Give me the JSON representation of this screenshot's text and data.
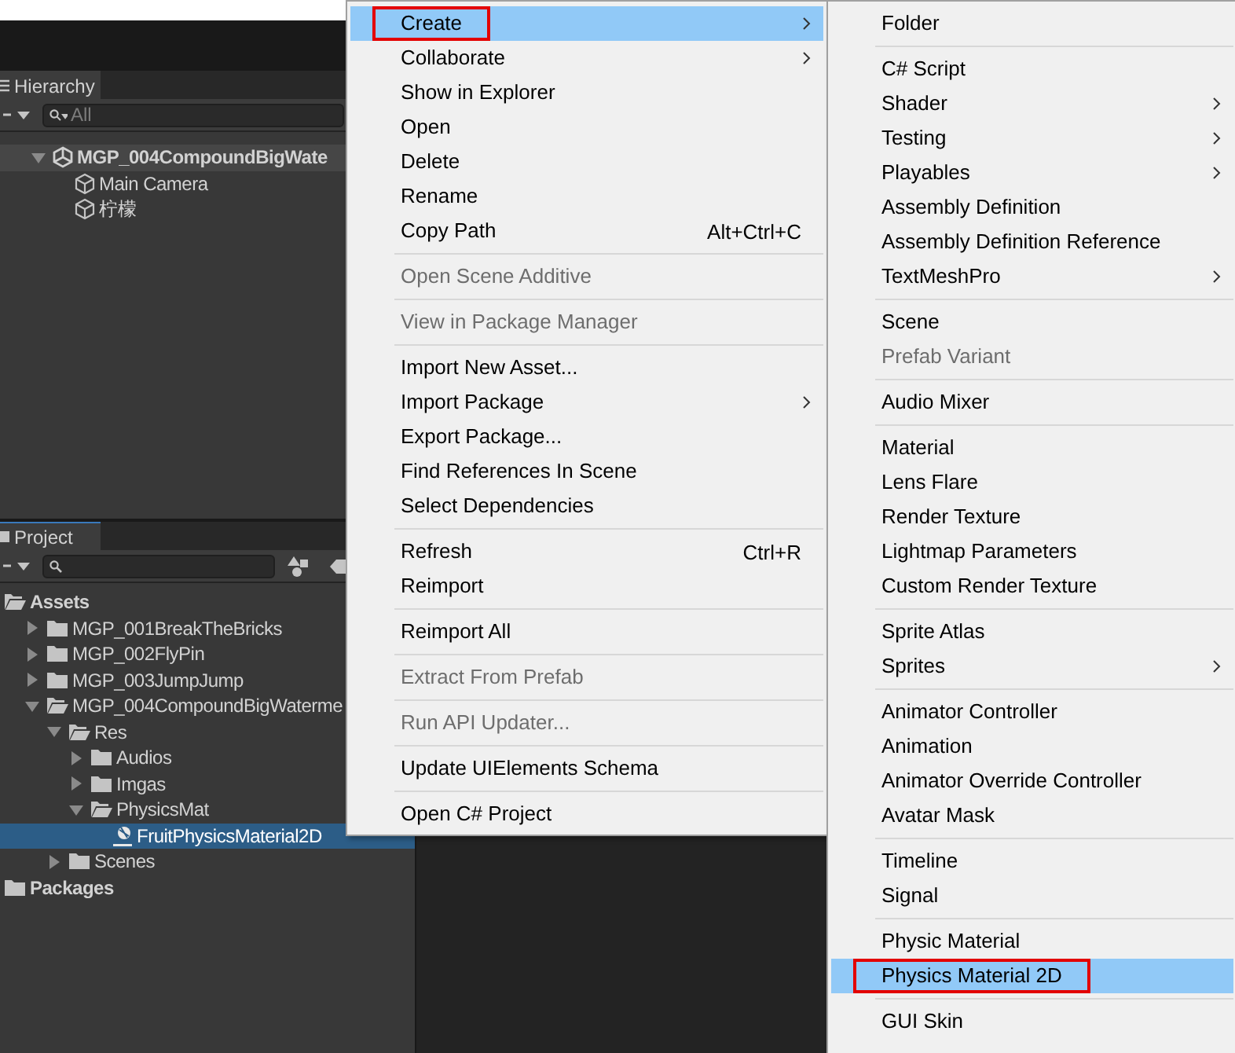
{
  "hierarchy": {
    "tab": "Hierarchy",
    "search_placeholder": "All",
    "tree": [
      {
        "label": "MGP_004CompoundBigWate",
        "kind": "scene",
        "expanded": true,
        "selected": false,
        "children": [
          {
            "label": "Main Camera",
            "kind": "object",
            "selected": false
          },
          {
            "label": "柠檬",
            "kind": "object",
            "selected": false
          }
        ]
      }
    ]
  },
  "project": {
    "tab": "Project",
    "tree": [
      {
        "label": "Assets",
        "kind": "folder",
        "expanded": true,
        "selected": false,
        "children": [
          {
            "label": "MGP_001BreakTheBricks",
            "kind": "folder",
            "expanded": false,
            "selected": false
          },
          {
            "label": "MGP_002FlyPin",
            "kind": "folder",
            "expanded": false,
            "selected": false
          },
          {
            "label": "MGP_003JumpJump",
            "kind": "folder",
            "expanded": false,
            "selected": false
          },
          {
            "label": "MGP_004CompoundBigWaterme",
            "kind": "folder",
            "expanded": true,
            "selected": false,
            "children": [
              {
                "label": "Res",
                "kind": "folder",
                "expanded": true,
                "selected": false,
                "children": [
                  {
                    "label": "Audios",
                    "kind": "folder",
                    "expanded": false,
                    "selected": false
                  },
                  {
                    "label": "Imgas",
                    "kind": "folder",
                    "expanded": false,
                    "selected": false
                  },
                  {
                    "label": "PhysicsMat",
                    "kind": "folder",
                    "expanded": true,
                    "selected": false,
                    "children": [
                      {
                        "label": "FruitPhysicsMaterial2D",
                        "kind": "asset",
                        "selected": true
                      }
                    ]
                  }
                ]
              },
              {
                "label": "Scenes",
                "kind": "folder",
                "expanded": false,
                "selected": false
              }
            ]
          }
        ]
      },
      {
        "label": "Packages",
        "kind": "folder",
        "expanded": false,
        "selected": false
      }
    ]
  },
  "context_menu": {
    "groups": [
      [
        {
          "label": "Create",
          "submenu": true,
          "disabled": false,
          "selected": true,
          "outlined": true
        },
        {
          "label": "Collaborate",
          "submenu": true,
          "disabled": false,
          "selected": false,
          "outlined": false
        },
        {
          "label": "Show in Explorer",
          "submenu": false,
          "disabled": false,
          "selected": false,
          "outlined": false
        },
        {
          "label": "Open",
          "submenu": false,
          "disabled": false,
          "selected": false,
          "outlined": false
        },
        {
          "label": "Delete",
          "submenu": false,
          "disabled": false,
          "selected": false,
          "outlined": false
        },
        {
          "label": "Rename",
          "submenu": false,
          "disabled": false,
          "selected": false,
          "outlined": false
        },
        {
          "label": "Copy Path",
          "shortcut": "Alt+Ctrl+C",
          "submenu": false,
          "disabled": false,
          "selected": false,
          "outlined": false
        }
      ],
      [
        {
          "label": "Open Scene Additive",
          "submenu": false,
          "disabled": true,
          "selected": false,
          "outlined": false
        }
      ],
      [
        {
          "label": "View in Package Manager",
          "submenu": false,
          "disabled": true,
          "selected": false,
          "outlined": false
        }
      ],
      [
        {
          "label": "Import New Asset...",
          "submenu": false,
          "disabled": false,
          "selected": false,
          "outlined": false
        },
        {
          "label": "Import Package",
          "submenu": true,
          "disabled": false,
          "selected": false,
          "outlined": false
        },
        {
          "label": "Export Package...",
          "submenu": false,
          "disabled": false,
          "selected": false,
          "outlined": false
        },
        {
          "label": "Find References In Scene",
          "submenu": false,
          "disabled": false,
          "selected": false,
          "outlined": false
        },
        {
          "label": "Select Dependencies",
          "submenu": false,
          "disabled": false,
          "selected": false,
          "outlined": false
        }
      ],
      [
        {
          "label": "Refresh",
          "shortcut": "Ctrl+R",
          "submenu": false,
          "disabled": false,
          "selected": false,
          "outlined": false
        },
        {
          "label": "Reimport",
          "submenu": false,
          "disabled": false,
          "selected": false,
          "outlined": false
        }
      ],
      [
        {
          "label": "Reimport All",
          "submenu": false,
          "disabled": false,
          "selected": false,
          "outlined": false
        }
      ],
      [
        {
          "label": "Extract From Prefab",
          "submenu": false,
          "disabled": true,
          "selected": false,
          "outlined": false
        }
      ],
      [
        {
          "label": "Run API Updater...",
          "submenu": false,
          "disabled": true,
          "selected": false,
          "outlined": false
        }
      ],
      [
        {
          "label": "Update UIElements Schema",
          "submenu": false,
          "disabled": false,
          "selected": false,
          "outlined": false
        }
      ],
      [
        {
          "label": "Open C# Project",
          "submenu": false,
          "disabled": false,
          "selected": false,
          "outlined": false
        }
      ]
    ]
  },
  "create_submenu": {
    "groups": [
      [
        {
          "label": "Folder",
          "submenu": false,
          "disabled": false,
          "selected": false,
          "outlined": false
        }
      ],
      [
        {
          "label": "C# Script",
          "submenu": false,
          "disabled": false,
          "selected": false,
          "outlined": false
        },
        {
          "label": "Shader",
          "submenu": true,
          "disabled": false,
          "selected": false,
          "outlined": false
        },
        {
          "label": "Testing",
          "submenu": true,
          "disabled": false,
          "selected": false,
          "outlined": false
        },
        {
          "label": "Playables",
          "submenu": true,
          "disabled": false,
          "selected": false,
          "outlined": false
        },
        {
          "label": "Assembly Definition",
          "submenu": false,
          "disabled": false,
          "selected": false,
          "outlined": false
        },
        {
          "label": "Assembly Definition Reference",
          "submenu": false,
          "disabled": false,
          "selected": false,
          "outlined": false
        },
        {
          "label": "TextMeshPro",
          "submenu": true,
          "disabled": false,
          "selected": false,
          "outlined": false
        }
      ],
      [
        {
          "label": "Scene",
          "submenu": false,
          "disabled": false,
          "selected": false,
          "outlined": false
        },
        {
          "label": "Prefab Variant",
          "submenu": false,
          "disabled": true,
          "selected": false,
          "outlined": false
        }
      ],
      [
        {
          "label": "Audio Mixer",
          "submenu": false,
          "disabled": false,
          "selected": false,
          "outlined": false
        }
      ],
      [
        {
          "label": "Material",
          "submenu": false,
          "disabled": false,
          "selected": false,
          "outlined": false
        },
        {
          "label": "Lens Flare",
          "submenu": false,
          "disabled": false,
          "selected": false,
          "outlined": false
        },
        {
          "label": "Render Texture",
          "submenu": false,
          "disabled": false,
          "selected": false,
          "outlined": false
        },
        {
          "label": "Lightmap Parameters",
          "submenu": false,
          "disabled": false,
          "selected": false,
          "outlined": false
        },
        {
          "label": "Custom Render Texture",
          "submenu": false,
          "disabled": false,
          "selected": false,
          "outlined": false
        }
      ],
      [
        {
          "label": "Sprite Atlas",
          "submenu": false,
          "disabled": false,
          "selected": false,
          "outlined": false
        },
        {
          "label": "Sprites",
          "submenu": true,
          "disabled": false,
          "selected": false,
          "outlined": false
        }
      ],
      [
        {
          "label": "Animator Controller",
          "submenu": false,
          "disabled": false,
          "selected": false,
          "outlined": false
        },
        {
          "label": "Animation",
          "submenu": false,
          "disabled": false,
          "selected": false,
          "outlined": false
        },
        {
          "label": "Animator Override Controller",
          "submenu": false,
          "disabled": false,
          "selected": false,
          "outlined": false
        },
        {
          "label": "Avatar Mask",
          "submenu": false,
          "disabled": false,
          "selected": false,
          "outlined": false
        }
      ],
      [
        {
          "label": "Timeline",
          "submenu": false,
          "disabled": false,
          "selected": false,
          "outlined": false
        },
        {
          "label": "Signal",
          "submenu": false,
          "disabled": false,
          "selected": false,
          "outlined": false
        }
      ],
      [
        {
          "label": "Physic Material",
          "submenu": false,
          "disabled": false,
          "selected": false,
          "outlined": false
        },
        {
          "label": "Physics Material 2D",
          "submenu": false,
          "disabled": false,
          "selected": true,
          "outlined": true
        }
      ],
      [
        {
          "label": "GUI Skin",
          "submenu": false,
          "disabled": false,
          "selected": false,
          "outlined": false
        }
      ]
    ]
  }
}
